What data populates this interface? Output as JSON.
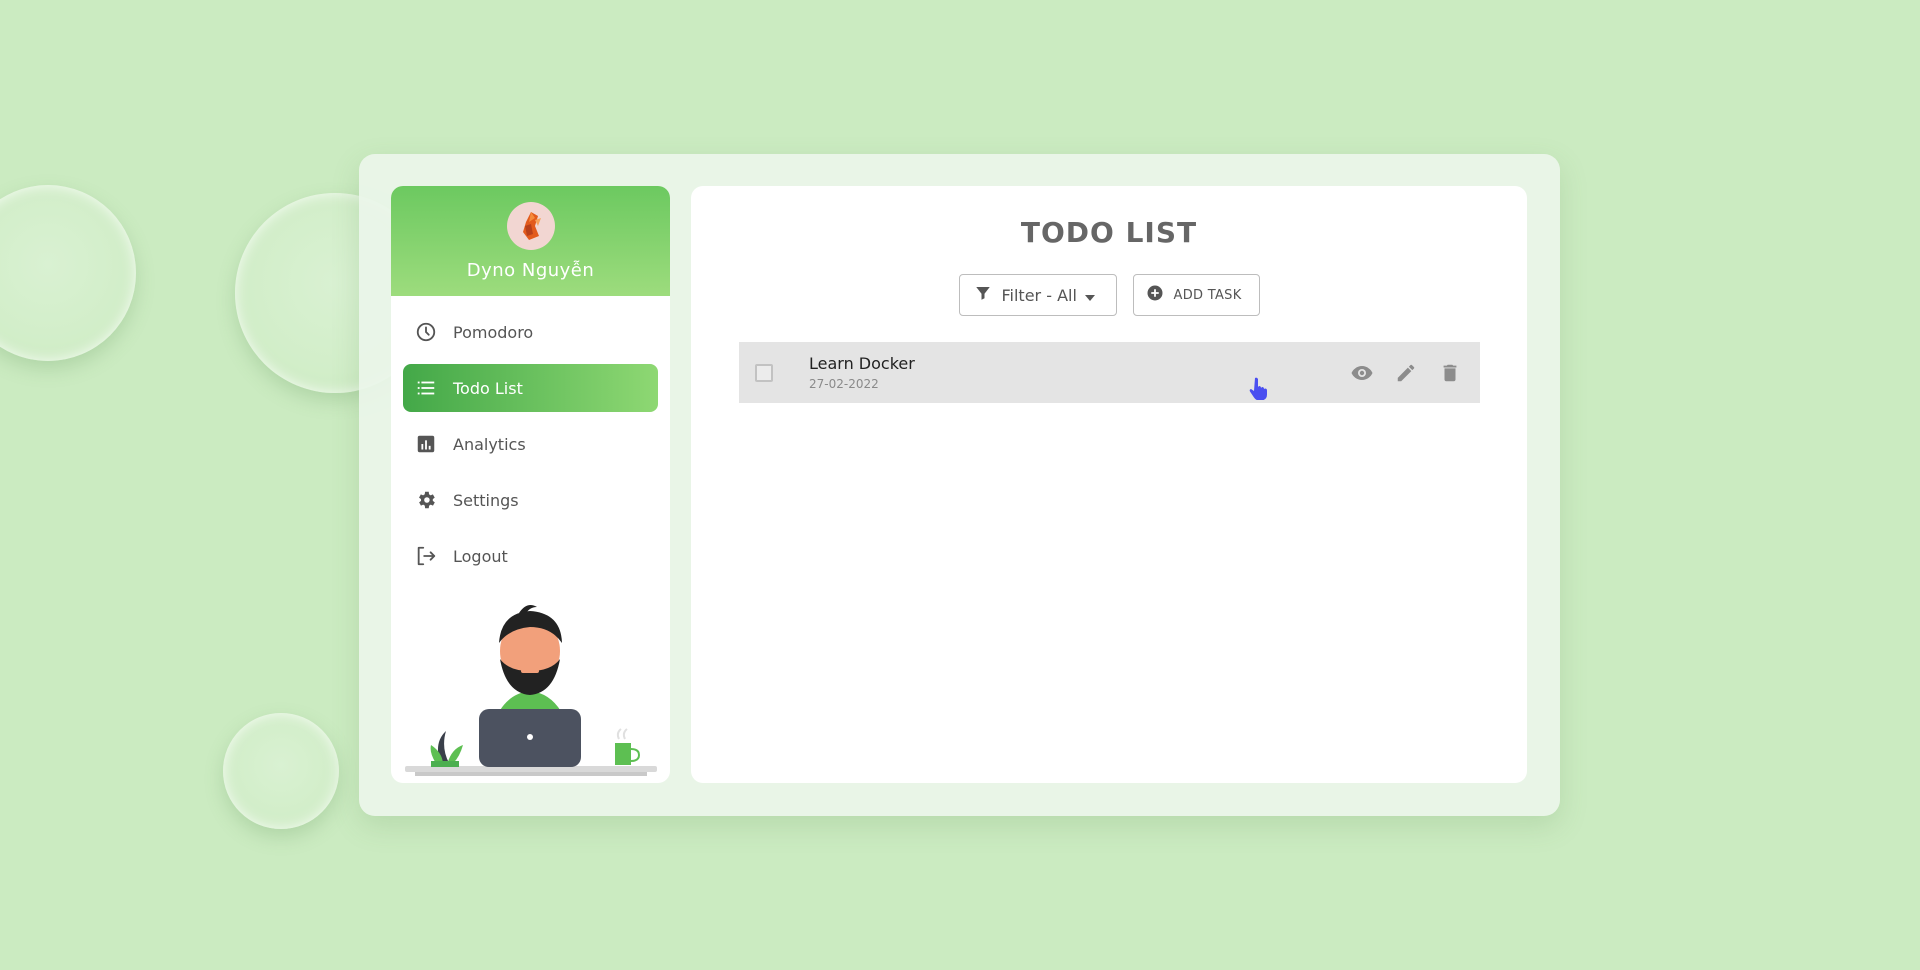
{
  "user": {
    "name": "Dyno Nguyễn"
  },
  "sidebar": {
    "items": [
      {
        "label": "Pomodoro",
        "icon": "clock-icon"
      },
      {
        "label": "Todo List",
        "icon": "list-icon",
        "active": true
      },
      {
        "label": "Analytics",
        "icon": "analytics-icon"
      },
      {
        "label": "Settings",
        "icon": "gear-icon"
      },
      {
        "label": "Logout",
        "icon": "logout-icon"
      }
    ]
  },
  "main": {
    "title": "TODO LIST",
    "filter_label": "Filter - All",
    "add_task_label": "ADD TASK"
  },
  "tasks": [
    {
      "title": "Learn Docker",
      "date": "27-02-2022",
      "completed": false
    }
  ],
  "colors": {
    "background": "#cbebc1",
    "accent": "#4caf50",
    "accent_light": "#9ddc7d"
  }
}
